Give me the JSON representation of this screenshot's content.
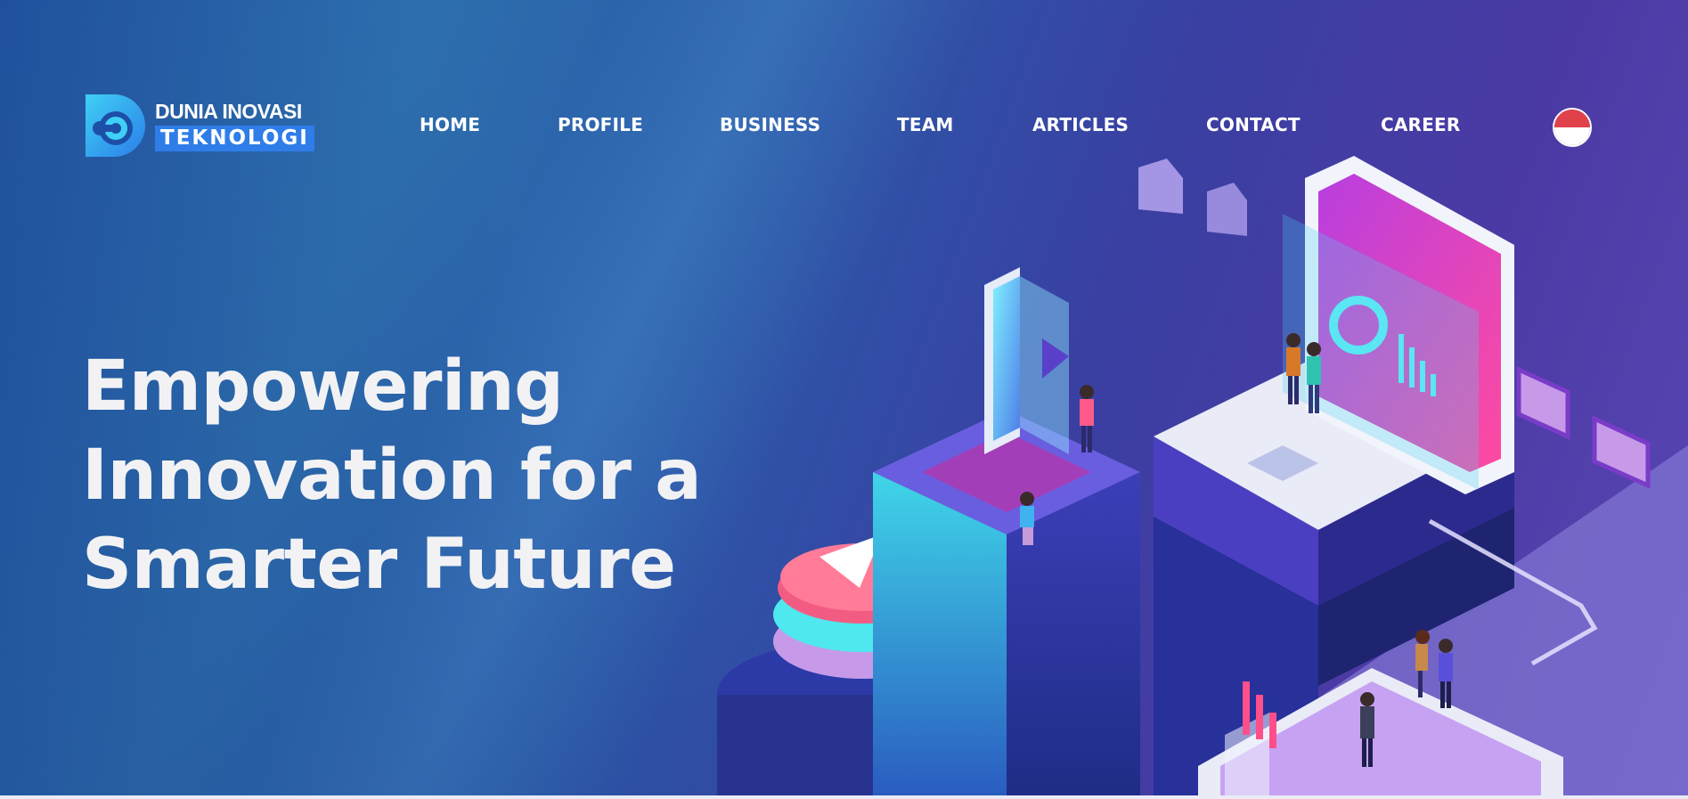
{
  "brand": {
    "line1": "DUNIA INOVASI",
    "line2": "TEKNOLOGI",
    "icon": "logo-d-mark",
    "accent": "#2f7de8"
  },
  "nav": {
    "items": [
      {
        "label": "HOME"
      },
      {
        "label": "PROFILE"
      },
      {
        "label": "BUSINESS"
      },
      {
        "label": "TEAM"
      },
      {
        "label": "ARTICLES"
      },
      {
        "label": "CONTACT"
      },
      {
        "label": "CAREER"
      }
    ],
    "language_icon": "indonesia-flag-icon"
  },
  "hero": {
    "headline_lines": [
      "Empowering",
      "Innovation for a",
      "Smarter Future"
    ],
    "background_colors": [
      "#2256a3",
      "#3a3fa2",
      "#5a47b4"
    ]
  },
  "colors": {
    "text": "#ffffff",
    "flag_red": "#e0414b",
    "pink": "#f04d8a",
    "cyan": "#33e0e6",
    "purple": "#7a4ed6"
  }
}
